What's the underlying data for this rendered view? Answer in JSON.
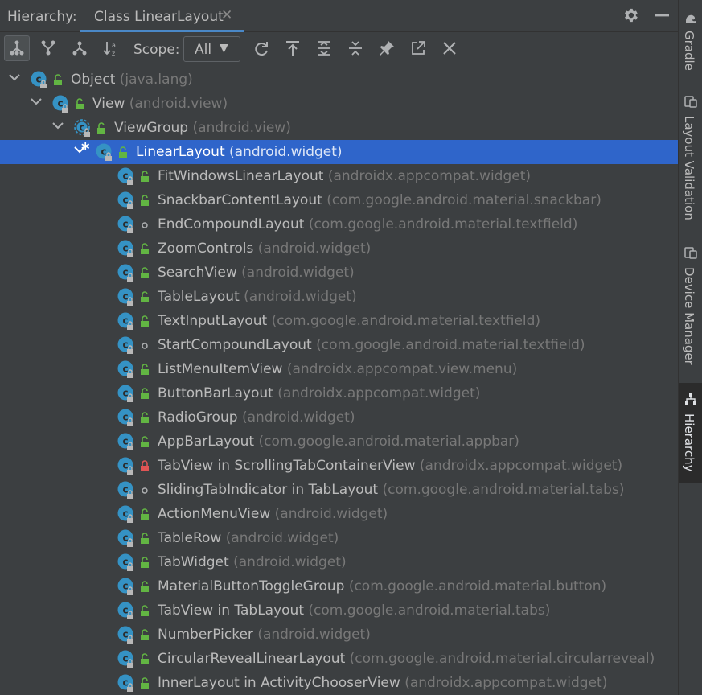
{
  "panel": {
    "title": "Hierarchy:",
    "tab_label": "Class LinearLayout",
    "tab_close": "✕"
  },
  "toolbar": {
    "scope_label": "Scope:",
    "scope_value": "All",
    "scope_arrow": "▼"
  },
  "icons": {
    "subtypes": "subtypes-hierarchy-icon",
    "supertypes": "supertypes-hierarchy-icon",
    "class_hierarchy": "class-hierarchy-icon",
    "sort": "sort-alphabetically-icon",
    "refresh": "refresh-icon",
    "base_on_class": "base-on-this-class-icon",
    "expand_all": "expand-all-icon",
    "collapse_all": "collapse-all-icon",
    "pin": "pin-icon",
    "export": "open-in-editor-icon",
    "close": "close-icon",
    "settings": "gear-icon",
    "minimize": "minimize-icon"
  },
  "colors": {
    "background": "#3c3f41",
    "selection": "#2f65ca",
    "class_icon": "#3592c4",
    "public_badge": "#62b543",
    "private_badge": "#e05555",
    "package_text": "#787878"
  },
  "tree": [
    {
      "name": "Object",
      "pkg": "(java.lang)",
      "depth": 0,
      "expanded": true,
      "badge": "public"
    },
    {
      "name": "View",
      "pkg": "(android.view)",
      "depth": 1,
      "expanded": true,
      "badge": "public"
    },
    {
      "name": "ViewGroup",
      "pkg": "(android.view)",
      "depth": 2,
      "expanded": true,
      "badge": "public",
      "abstract": true
    },
    {
      "name": "LinearLayout",
      "pkg": "(android.widget)",
      "depth": 3,
      "expanded": true,
      "badge": "public",
      "current": true,
      "selected": true,
      "marker": "*"
    },
    {
      "name": "FitWindowsLinearLayout",
      "pkg": "(androidx.appcompat.widget)",
      "depth": 4,
      "badge": "public"
    },
    {
      "name": "SnackbarContentLayout",
      "pkg": "(com.google.android.material.snackbar)",
      "depth": 4,
      "badge": "public"
    },
    {
      "name": "EndCompoundLayout",
      "pkg": "(com.google.android.material.textfield)",
      "depth": 4,
      "badge": "package"
    },
    {
      "name": "ZoomControls",
      "pkg": "(android.widget)",
      "depth": 4,
      "badge": "public"
    },
    {
      "name": "SearchView",
      "pkg": "(android.widget)",
      "depth": 4,
      "badge": "public"
    },
    {
      "name": "TableLayout",
      "pkg": "(android.widget)",
      "depth": 4,
      "badge": "public"
    },
    {
      "name": "TextInputLayout",
      "pkg": "(com.google.android.material.textfield)",
      "depth": 4,
      "badge": "public"
    },
    {
      "name": "StartCompoundLayout",
      "pkg": "(com.google.android.material.textfield)",
      "depth": 4,
      "badge": "package"
    },
    {
      "name": "ListMenuItemView",
      "pkg": "(androidx.appcompat.view.menu)",
      "depth": 4,
      "badge": "public"
    },
    {
      "name": "ButtonBarLayout",
      "pkg": "(androidx.appcompat.widget)",
      "depth": 4,
      "badge": "public"
    },
    {
      "name": "RadioGroup",
      "pkg": "(android.widget)",
      "depth": 4,
      "badge": "public"
    },
    {
      "name": "AppBarLayout",
      "pkg": "(com.google.android.material.appbar)",
      "depth": 4,
      "badge": "public"
    },
    {
      "name": "TabView in ScrollingTabContainerView",
      "pkg": "(androidx.appcompat.widget)",
      "depth": 4,
      "badge": "private"
    },
    {
      "name": "SlidingTabIndicator in TabLayout",
      "pkg": "(com.google.android.material.tabs)",
      "depth": 4,
      "badge": "package"
    },
    {
      "name": "ActionMenuView",
      "pkg": "(android.widget)",
      "depth": 4,
      "badge": "public"
    },
    {
      "name": "TableRow",
      "pkg": "(android.widget)",
      "depth": 4,
      "badge": "public"
    },
    {
      "name": "TabWidget",
      "pkg": "(android.widget)",
      "depth": 4,
      "badge": "public"
    },
    {
      "name": "MaterialButtonToggleGroup",
      "pkg": "(com.google.android.material.button)",
      "depth": 4,
      "badge": "public"
    },
    {
      "name": "TabView in TabLayout",
      "pkg": "(com.google.android.material.tabs)",
      "depth": 4,
      "badge": "public"
    },
    {
      "name": "NumberPicker",
      "pkg": "(android.widget)",
      "depth": 4,
      "badge": "public"
    },
    {
      "name": "CircularRevealLinearLayout",
      "pkg": "(com.google.android.material.circularreveal)",
      "depth": 4,
      "badge": "public"
    },
    {
      "name": "InnerLayout in ActivityChooserView",
      "pkg": "(androidx.appcompat.widget)",
      "depth": 4,
      "badge": "public"
    }
  ],
  "side_tabs": [
    {
      "label": "Gradle",
      "icon": "gradle-icon"
    },
    {
      "label": "Layout Validation",
      "icon": "layout-validation-icon"
    },
    {
      "label": "Device Manager",
      "icon": "device-manager-icon"
    },
    {
      "label": "Hierarchy",
      "icon": "hierarchy-icon",
      "active": true
    }
  ]
}
